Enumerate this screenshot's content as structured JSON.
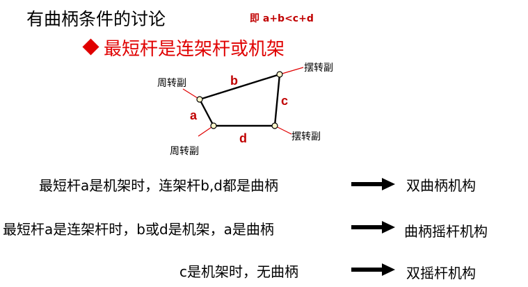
{
  "header": {
    "title": "有曲柄条件的讨论",
    "condition": "即 a+b<c+d",
    "subtitle": "最短杆是连架杆或机架"
  },
  "diagram": {
    "label_a": "a",
    "label_b": "b",
    "label_c": "c",
    "label_d": "d",
    "joint_top_left": "周转副",
    "joint_bottom_left": "周转副",
    "joint_top_right": "摆转副",
    "joint_bottom_right": "摆转副",
    "colors": {
      "link": "#000000",
      "joint_fill": "#fff8cc",
      "leader": "#e00000",
      "label": "#c00000"
    }
  },
  "cases": [
    {
      "text": "最短杆a是机架时，连架杆b,d都是曲柄",
      "result": "双曲柄机构"
    },
    {
      "text": "最短杆a是连架杆时，b或d是机架，a是曲柄",
      "result": "曲柄摇杆机构"
    },
    {
      "text": "c是机架时，无曲柄",
      "result": "双摇杆机构"
    }
  ]
}
